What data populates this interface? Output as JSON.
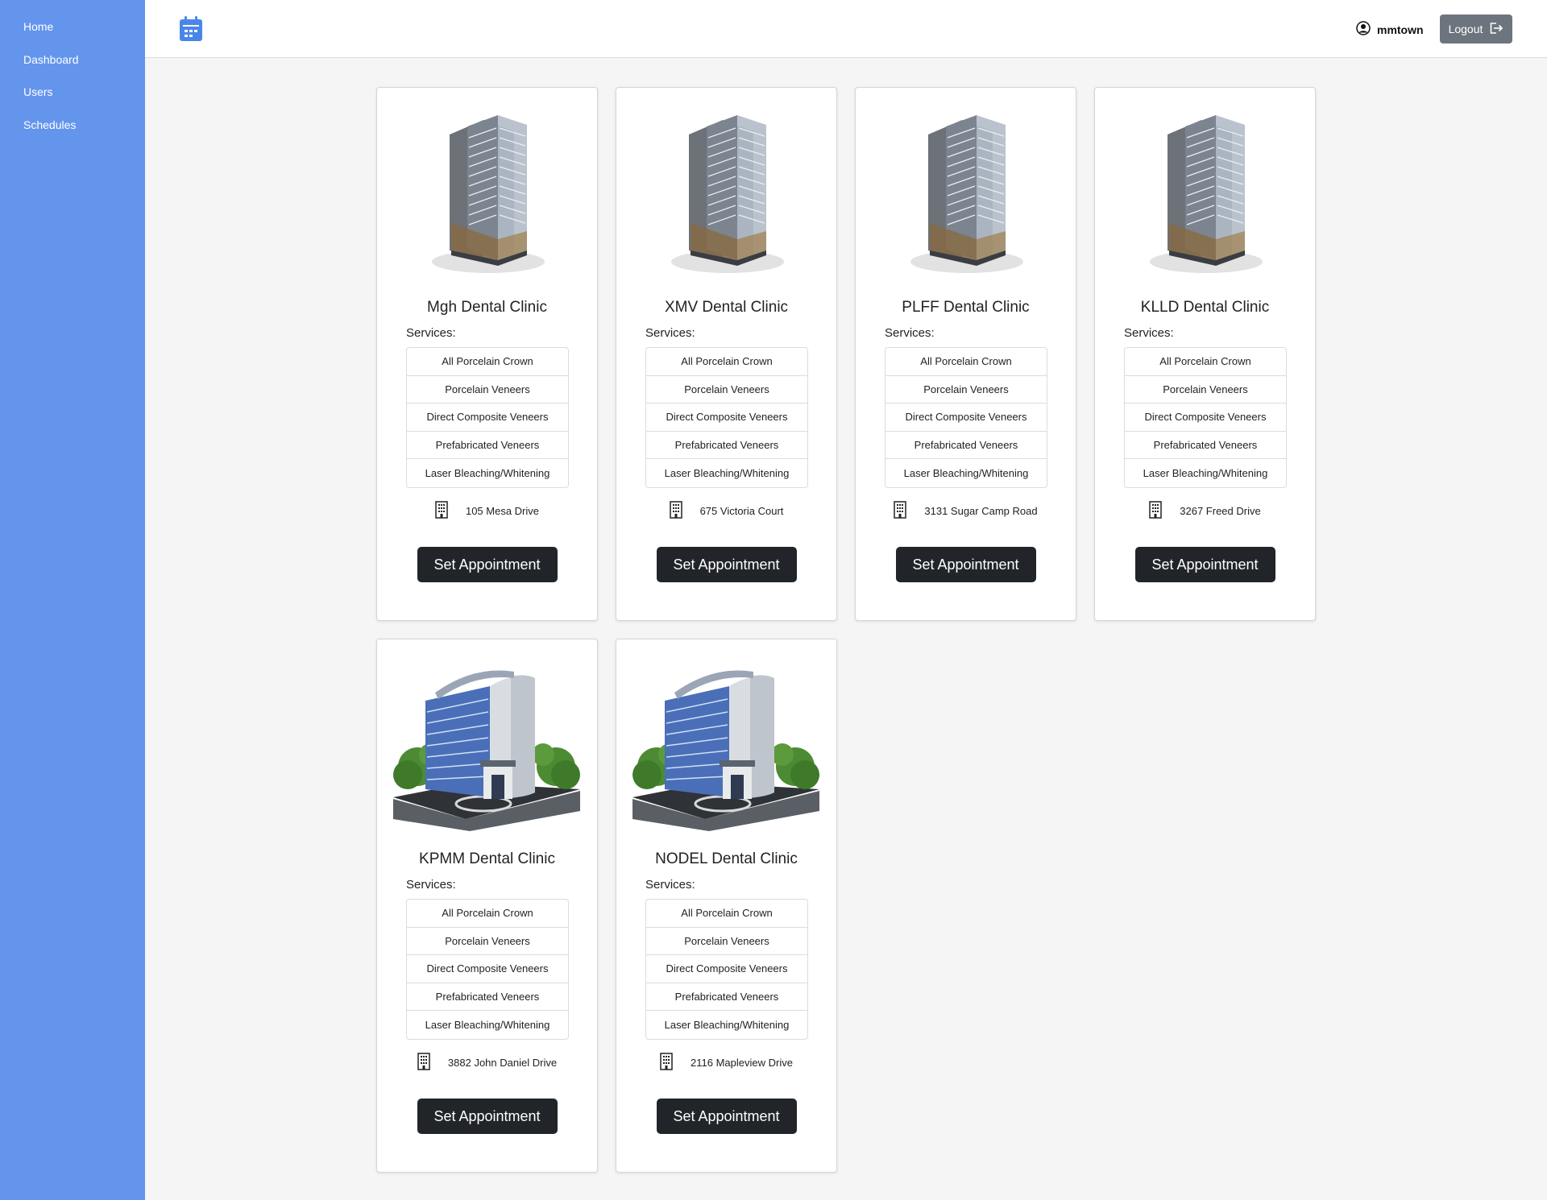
{
  "sidebar": {
    "items": [
      {
        "label": "Home"
      },
      {
        "label": "Dashboard"
      },
      {
        "label": "Users"
      },
      {
        "label": "Schedules"
      }
    ]
  },
  "header": {
    "logo_icon": "calendar-icon",
    "username": "mmtown",
    "user_icon": "user-circle-icon",
    "logout_label": "Logout",
    "logout_icon": "logout-icon"
  },
  "colors": {
    "sidebar": "#6495ed",
    "button_dark": "#212529",
    "logout_button": "#6c757d",
    "background": "#f5f5f5"
  },
  "clinics": [
    {
      "name": "Mgh Dental Clinic",
      "image": "tower-building",
      "services_label": "Services:",
      "services": [
        "All Porcelain Crown",
        "Porcelain Veneers",
        "Direct Composite Veneers",
        "Prefabricated Veneers",
        "Laser Bleaching/Whitening"
      ],
      "address": "105 Mesa Drive",
      "button": "Set Appointment"
    },
    {
      "name": "XMV Dental Clinic",
      "image": "tower-building",
      "services_label": "Services:",
      "services": [
        "All Porcelain Crown",
        "Porcelain Veneers",
        "Direct Composite Veneers",
        "Prefabricated Veneers",
        "Laser Bleaching/Whitening"
      ],
      "address": "675 Victoria Court",
      "button": "Set Appointment"
    },
    {
      "name": "PLFF Dental Clinic",
      "image": "tower-building",
      "services_label": "Services:",
      "services": [
        "All Porcelain Crown",
        "Porcelain Veneers",
        "Direct Composite Veneers",
        "Prefabricated Veneers",
        "Laser Bleaching/Whitening"
      ],
      "address": "3131 Sugar Camp Road",
      "button": "Set Appointment"
    },
    {
      "name": "KLLD Dental Clinic",
      "image": "tower-building",
      "services_label": "Services:",
      "services": [
        "All Porcelain Crown",
        "Porcelain Veneers",
        "Direct Composite Veneers",
        "Prefabricated Veneers",
        "Laser Bleaching/Whitening"
      ],
      "address": "3267 Freed Drive",
      "button": "Set Appointment"
    },
    {
      "name": "KPMM Dental Clinic",
      "image": "office-building",
      "services_label": "Services:",
      "services": [
        "All Porcelain Crown",
        "Porcelain Veneers",
        "Direct Composite Veneers",
        "Prefabricated Veneers",
        "Laser Bleaching/Whitening"
      ],
      "address": "3882 John Daniel Drive",
      "button": "Set Appointment"
    },
    {
      "name": "NODEL Dental Clinic",
      "image": "office-building",
      "services_label": "Services:",
      "services": [
        "All Porcelain Crown",
        "Porcelain Veneers",
        "Direct Composite Veneers",
        "Prefabricated Veneers",
        "Laser Bleaching/Whitening"
      ],
      "address": "2116 Mapleview Drive",
      "button": "Set Appointment"
    }
  ]
}
